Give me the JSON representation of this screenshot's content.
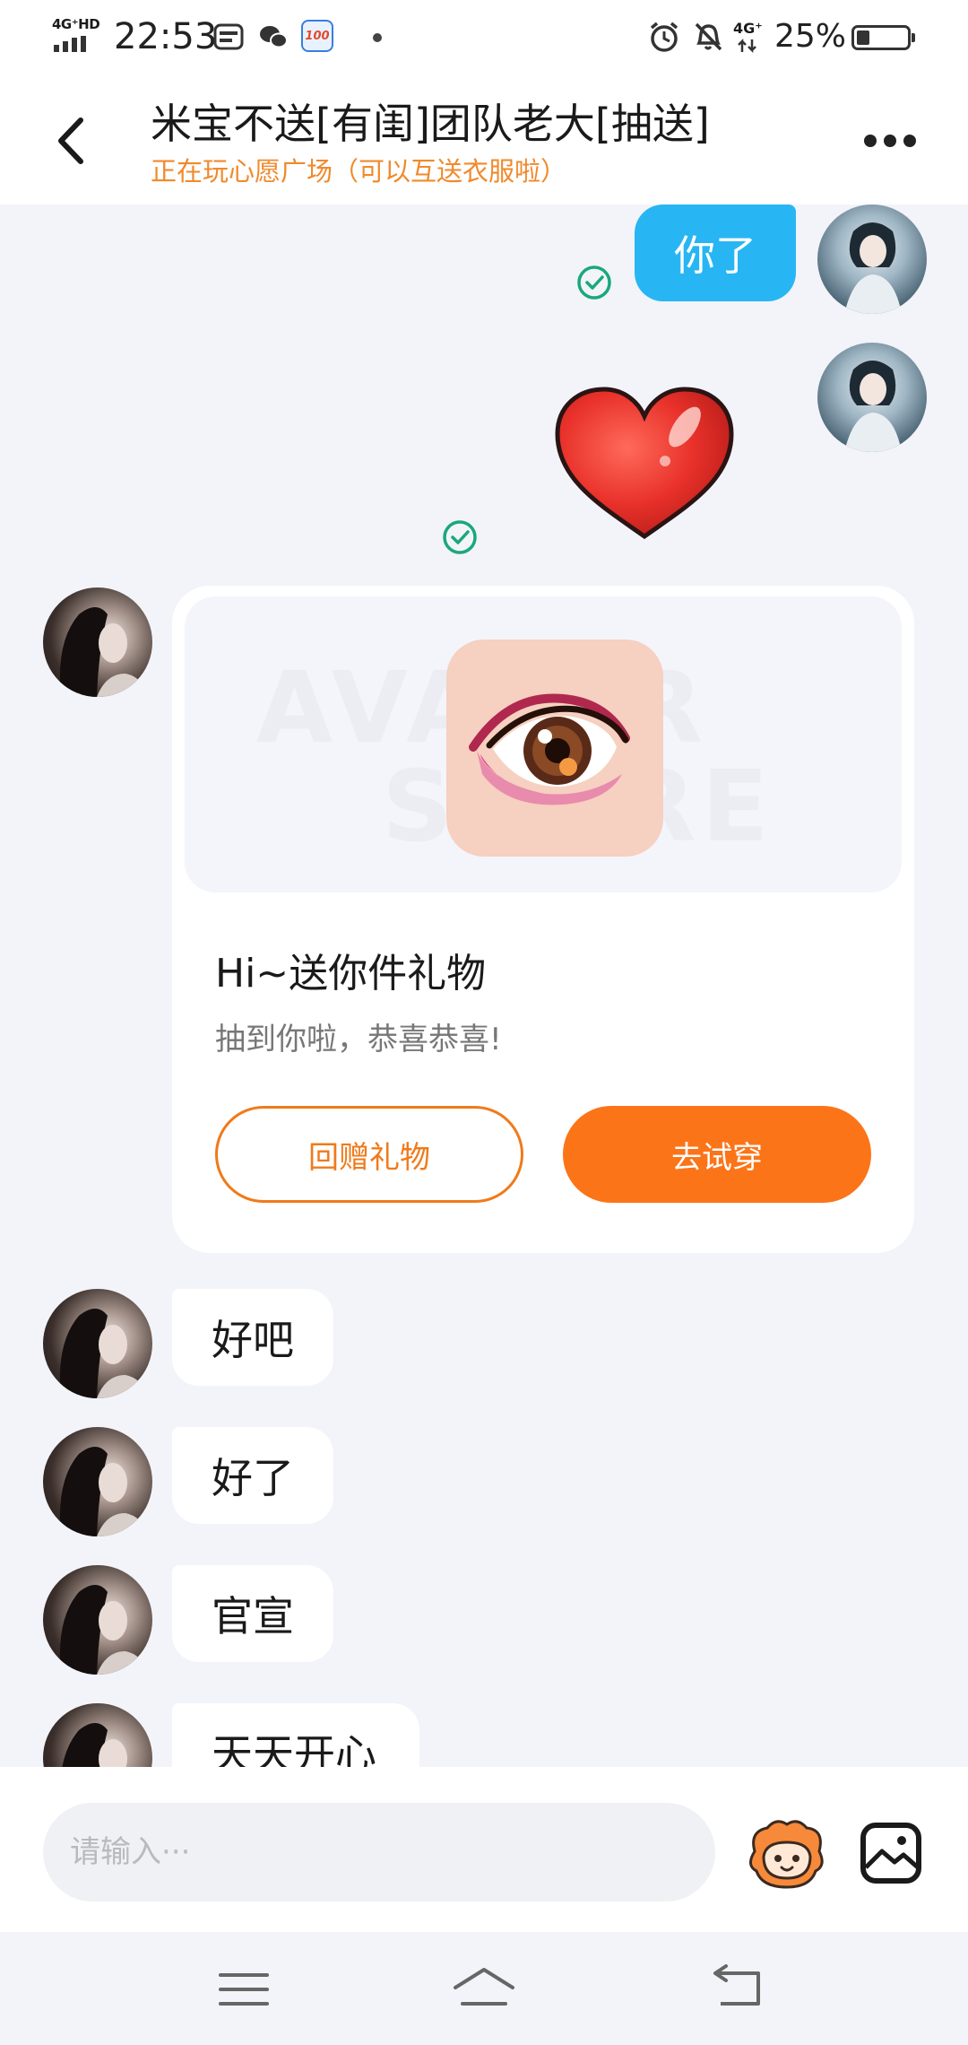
{
  "status_bar": {
    "network": "4G⁺HD",
    "time": "22:53",
    "app_badge": "100",
    "mobile_data": "4G⁺",
    "battery_text": "25%",
    "battery_level": 0.25
  },
  "header": {
    "title": "米宝不送[有闺]团队老大[抽送]",
    "subtitle": "正在玩心愿广场（可以互送衣服啦）"
  },
  "messages": {
    "me_text_1": "你了",
    "other_1": "好吧",
    "other_2": "好了",
    "other_3": "官宣",
    "other_4": "天天开心"
  },
  "gift_card": {
    "watermark_1": "AVATAR",
    "watermark_2": "STORE",
    "title": "Hi~送你件礼物",
    "description": "抽到你啦，恭喜恭喜!",
    "return_gift_label": "回赠礼物",
    "try_on_label": "去试穿"
  },
  "input": {
    "placeholder": "请输入···"
  },
  "colors": {
    "accent_orange": "#fc7418",
    "subtitle_orange": "#f08a2c",
    "my_bubble": "#27b6f3",
    "read_check": "#1aa87a"
  },
  "icons": [
    "back-arrow-icon",
    "more-icon",
    "read-check-icon",
    "heart-sticker",
    "eye-gift-icon",
    "emoji-mascot-icon",
    "image-icon",
    "menu-icon",
    "home-icon",
    "back-icon"
  ]
}
